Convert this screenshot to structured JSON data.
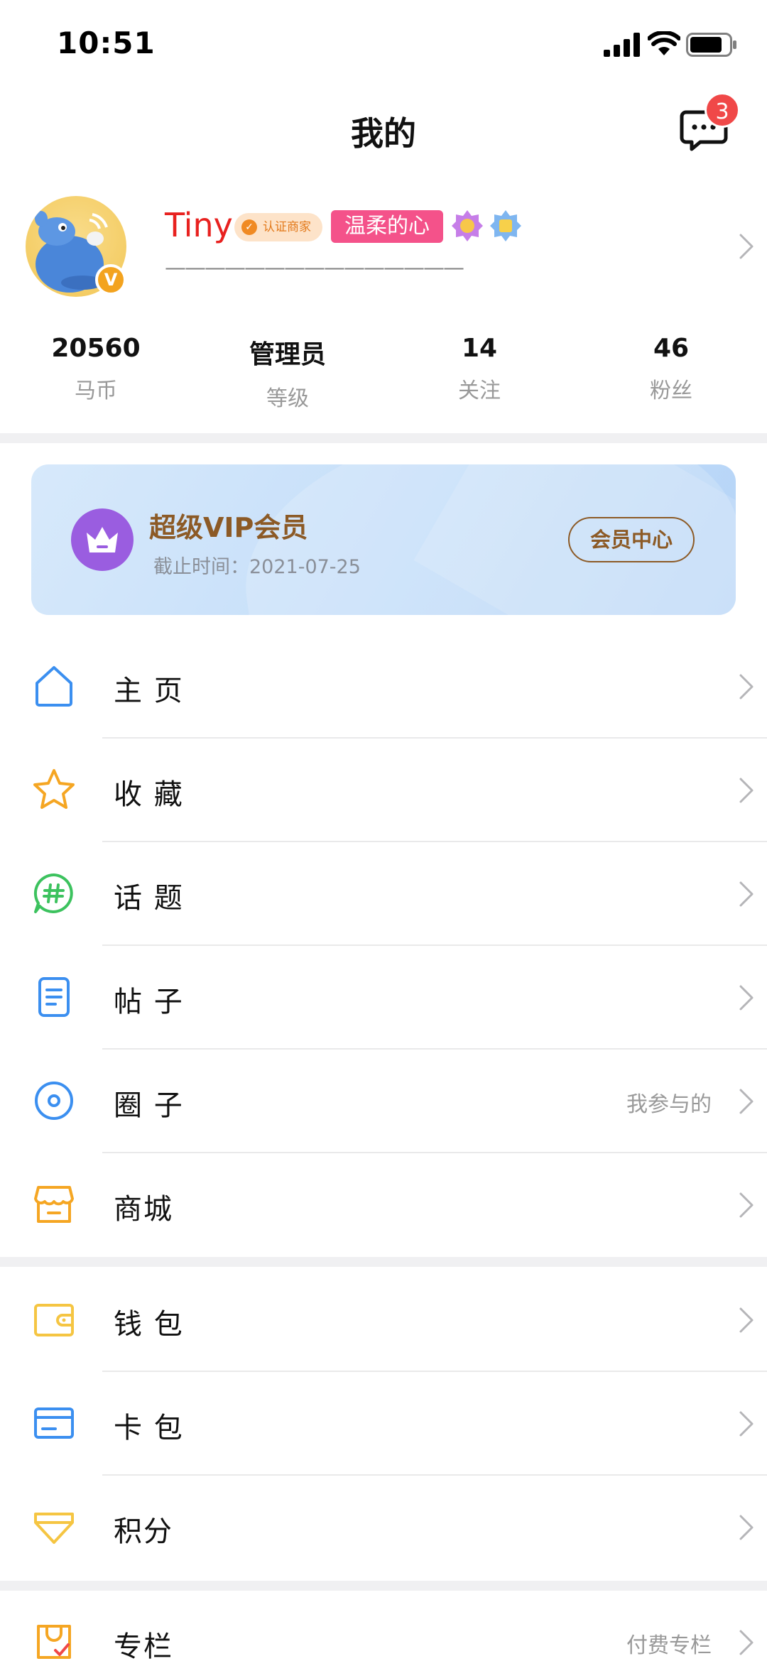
{
  "status_bar": {
    "time": "10:51"
  },
  "header": {
    "title": "我的",
    "message_badge": "3"
  },
  "profile": {
    "username": "Tiny",
    "cert_tag": "认证商家",
    "title_tag": "温柔的心",
    "signature": "———————————————",
    "avatar_badge": "V"
  },
  "stats": [
    {
      "value": "20560",
      "label": "马币"
    },
    {
      "value": "管理员",
      "label": "等级"
    },
    {
      "value": "14",
      "label": "关注"
    },
    {
      "value": "46",
      "label": "粉丝"
    }
  ],
  "vip": {
    "title": "超级VIP会员",
    "expire": "截止时间：2021-07-25",
    "center_button": "会员中心"
  },
  "menu": [
    {
      "label": "主 页",
      "extra": "",
      "icon": "home-icon"
    },
    {
      "label": "收 藏",
      "extra": "",
      "icon": "star-icon"
    },
    {
      "label": "话 题",
      "extra": "",
      "icon": "topic-hash-icon"
    },
    {
      "label": "帖 子",
      "extra": "",
      "icon": "post-doc-icon"
    },
    {
      "label": "圈 子",
      "extra": "我参与的",
      "icon": "circle-icon"
    },
    {
      "label": "商城",
      "extra": "",
      "icon": "shop-icon"
    },
    {
      "label": "钱 包",
      "extra": "",
      "icon": "wallet-icon"
    },
    {
      "label": "卡 包",
      "extra": "",
      "icon": "card-icon"
    },
    {
      "label": "积分",
      "extra": "",
      "icon": "points-icon"
    },
    {
      "label": "专栏",
      "extra": "付费专栏",
      "icon": "column-icon"
    }
  ],
  "colors": {
    "accent_blue": "#3b8ff0",
    "star_orange": "#f5a623",
    "topic_green": "#3cc25e",
    "badge_red": "#f04848",
    "vip_brown": "#8c5a26",
    "vip_purple": "#9a5de0"
  }
}
